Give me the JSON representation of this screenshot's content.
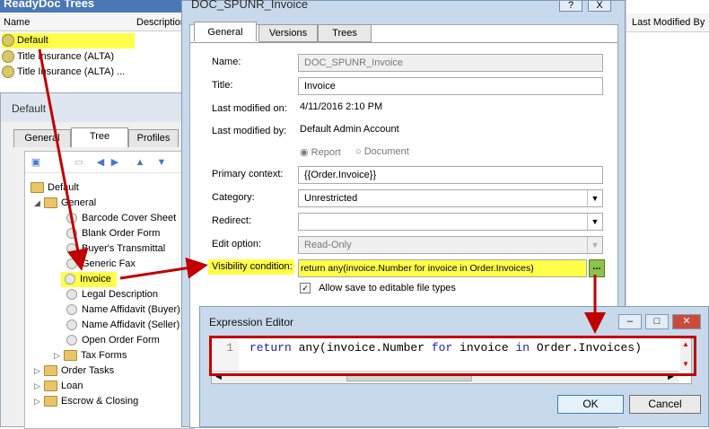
{
  "bg": {
    "title": "ReadyDoc Trees",
    "col_name": "Name",
    "col_desc": "Description",
    "col_modified": "Last Modified By",
    "rows": [
      "Default",
      "Title Insurance (ALTA)",
      "Title Insurance (ALTA) ..."
    ]
  },
  "def_window": {
    "title": "Default",
    "tabs": [
      "General",
      "Tree",
      "Profiles"
    ],
    "tree": {
      "root": "Default",
      "general": "General",
      "items": [
        "Barcode Cover Sheet",
        "Blank Order Form",
        "Buyer's Transmittal",
        "Generic Fax",
        "Invoice",
        "Legal Description",
        "Name Affidavit (Buyer)",
        "Name Affidavit (Seller)",
        "Open Order Form"
      ],
      "tax_forms": "Tax Forms",
      "others": [
        "Order Tasks",
        "Loan",
        "Escrow & Closing"
      ]
    }
  },
  "doc_window": {
    "title": "DOC_SPUNR_Invoice",
    "help_btn": "?",
    "close_btn": "X",
    "tabs": [
      "General",
      "Versions",
      "Trees"
    ],
    "labels": {
      "name": "Name:",
      "title": "Title:",
      "last_modified_on": "Last modified on:",
      "last_modified_by": "Last modified by:",
      "primary_context": "Primary context:",
      "category": "Category:",
      "redirect": "Redirect:",
      "edit_option": "Edit option:",
      "visibility": "Visibility condition:"
    },
    "values": {
      "name": "DOC_SPUNR_Invoice",
      "title": "Invoice",
      "last_modified_on": "4/11/2016 2:10 PM",
      "last_modified_by": "Default Admin Account",
      "radio_report": "Report",
      "radio_document": "Document",
      "primary_context": "{{Order.Invoice}}",
      "category": "Unrestricted",
      "redirect": "",
      "edit_option": "Read-Only",
      "visibility": "return any(invoice.Number for invoice in Order.Invoices)",
      "ellipsis": "...",
      "allow_save": "Allow save to editable file types"
    }
  },
  "expr_editor": {
    "title": "Expression Editor",
    "line_no": "1",
    "code": {
      "k1": "return",
      "t1": " any(invoice.Number ",
      "k2": "for",
      "t2": " invoice ",
      "k3": "in",
      "t3": " Order.Invoices)"
    },
    "ok": "OK",
    "cancel": "Cancel"
  },
  "colors": {
    "highlight": "#ffff4a",
    "annotation": "#c00000",
    "title_blue": "#4a78b5"
  }
}
